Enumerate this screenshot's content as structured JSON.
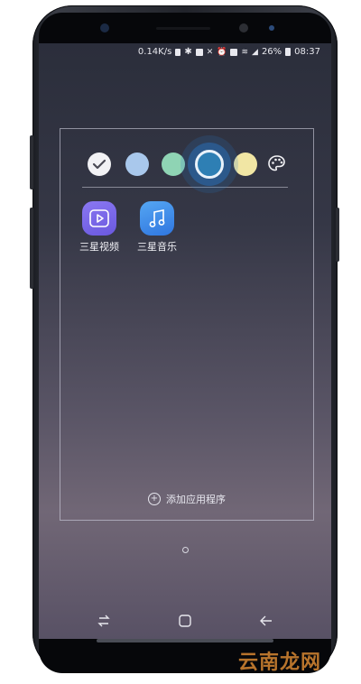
{
  "status_bar": {
    "network_speed": "0.14K/s",
    "battery": "26%",
    "time": "08:37"
  },
  "color_palette": {
    "colors": [
      "#f2f2f5",
      "#a9c8ec",
      "#8fd4b4",
      "#2e7fb4",
      "#f1e6a4"
    ],
    "selected_index": 3,
    "palette_icon": "palette-icon"
  },
  "folder": {
    "apps": [
      {
        "label": "三星视频",
        "icon": "video-play-icon",
        "color": "#7b68e8"
      },
      {
        "label": "三星音乐",
        "icon": "music-note-icon",
        "color": "#3e8ee8"
      }
    ],
    "add_apps_label": "添加应用程序"
  },
  "watermark": "云南龙网"
}
